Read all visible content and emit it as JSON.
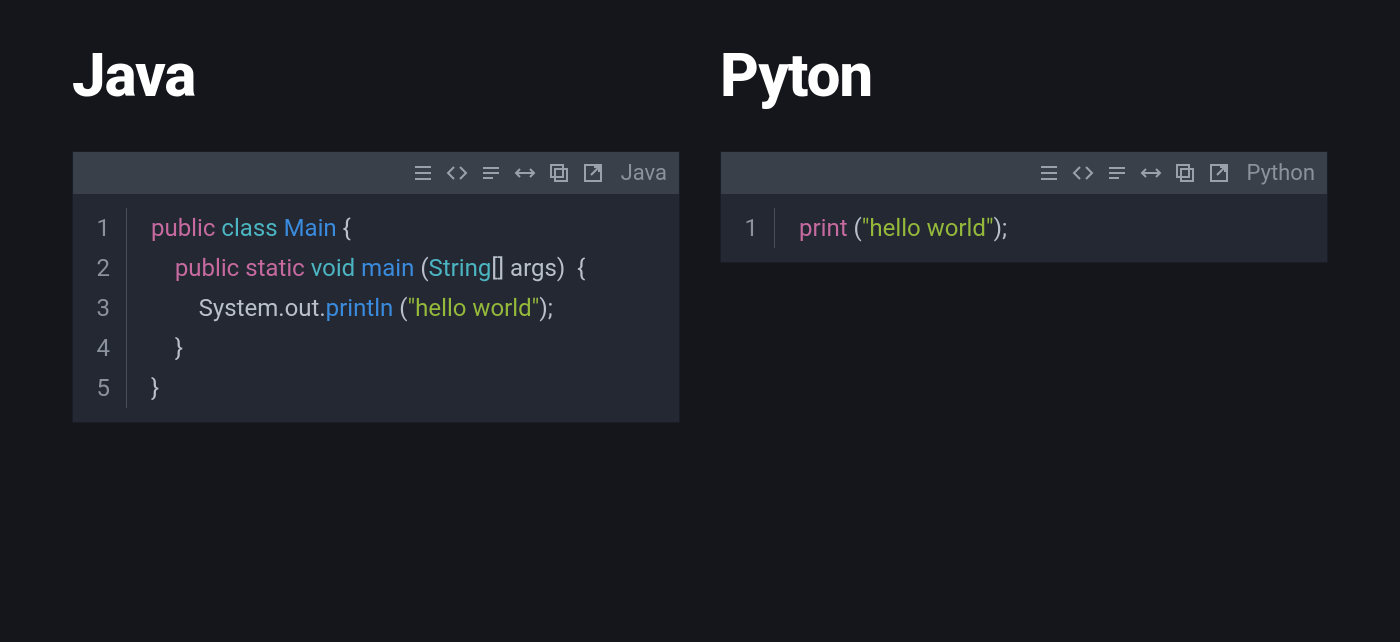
{
  "columns": [
    {
      "title": "Java",
      "header_lang": "Java",
      "lines": [
        {
          "num": "1",
          "indent": 0,
          "segments": [
            {
              "cls": "t-kw1",
              "text": "public"
            },
            {
              "cls": "",
              "text": " "
            },
            {
              "cls": "t-kw2",
              "text": "class"
            },
            {
              "cls": "",
              "text": " "
            },
            {
              "cls": "t-kw3",
              "text": "Main"
            },
            {
              "cls": "",
              "text": " "
            },
            {
              "cls": "t-pn",
              "text": "{"
            }
          ]
        },
        {
          "num": "2",
          "indent": 1,
          "segments": [
            {
              "cls": "t-kw1",
              "text": "public"
            },
            {
              "cls": "",
              "text": " "
            },
            {
              "cls": "t-kw1",
              "text": "static"
            },
            {
              "cls": "",
              "text": " "
            },
            {
              "cls": "t-kw2",
              "text": "void"
            },
            {
              "cls": "",
              "text": " "
            },
            {
              "cls": "t-kw3",
              "text": "main"
            },
            {
              "cls": "",
              "text": " "
            },
            {
              "cls": "t-pn",
              "text": "("
            },
            {
              "cls": "t-kw2",
              "text": "String"
            },
            {
              "cls": "t-pn",
              "text": "[] args)  {"
            }
          ]
        },
        {
          "num": "3",
          "indent": 2,
          "segments": [
            {
              "cls": "t-pn",
              "text": "System.out."
            },
            {
              "cls": "t-kw3",
              "text": "println"
            },
            {
              "cls": "",
              "text": " "
            },
            {
              "cls": "t-pn",
              "text": "("
            },
            {
              "cls": "t-str",
              "text": "\"hello world\""
            },
            {
              "cls": "t-pn",
              "text": ");"
            }
          ]
        },
        {
          "num": "4",
          "indent": 1,
          "segments": [
            {
              "cls": "t-pn",
              "text": "}"
            }
          ]
        },
        {
          "num": "5",
          "indent": 0,
          "segments": [
            {
              "cls": "t-pn",
              "text": "}"
            }
          ]
        }
      ]
    },
    {
      "title": "Pyton",
      "header_lang": "Python",
      "lines": [
        {
          "num": "1",
          "indent": 0,
          "segments": [
            {
              "cls": "t-kw1",
              "text": "print"
            },
            {
              "cls": "",
              "text": " "
            },
            {
              "cls": "t-pn",
              "text": "("
            },
            {
              "cls": "t-str",
              "text": "\"hello world\""
            },
            {
              "cls": "t-pn",
              "text": ");"
            }
          ]
        }
      ]
    }
  ],
  "toolbar_icons": [
    "lines-icon",
    "code-icon",
    "notes-icon",
    "stretch-icon",
    "copy-icon",
    "popout-icon"
  ]
}
